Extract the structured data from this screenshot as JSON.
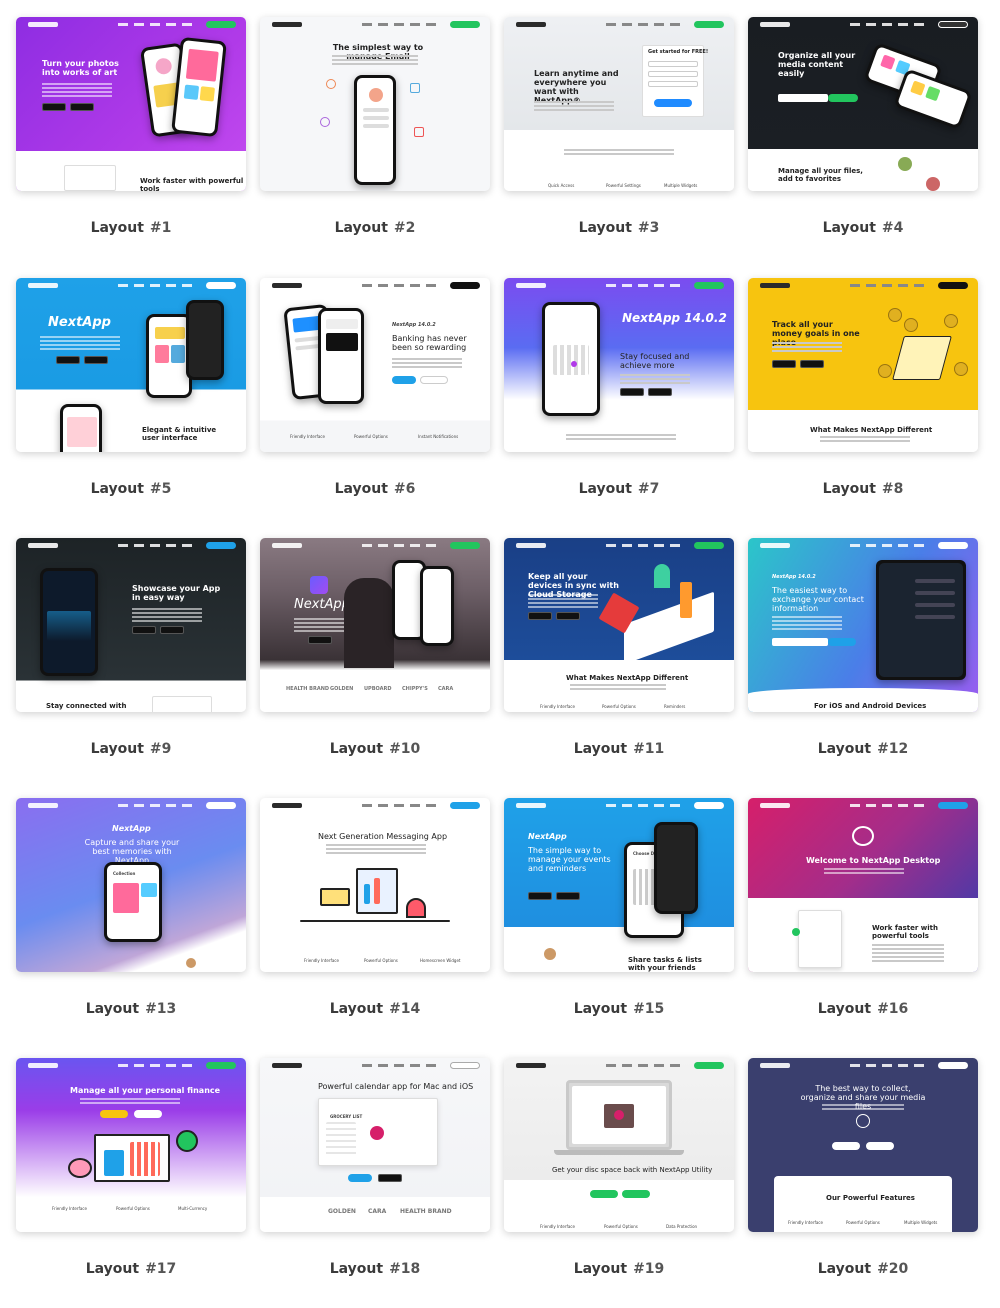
{
  "layouts": [
    {
      "label": "Layout",
      "num": "#1",
      "headline": "Turn your photos into works of art",
      "lower": "Work faster with powerful tools"
    },
    {
      "label": "Layout",
      "num": "#2",
      "headline": "The simplest way to manage Email"
    },
    {
      "label": "Layout",
      "num": "#3",
      "headline": "Learn anytime and everywhere you want with NextApp®",
      "form_title": "Get started for FREE!",
      "features": [
        "Quick Access",
        "Powerful Settings",
        "Multiple Widgets"
      ]
    },
    {
      "label": "Layout",
      "num": "#4",
      "headline": "Organize all your media content easily",
      "lower": "Manage all your files, add to favorites"
    },
    {
      "label": "Layout",
      "num": "#5",
      "headline": "NextApp",
      "lower": "Elegant & intuitive user interface"
    },
    {
      "label": "Layout",
      "num": "#6",
      "kicker": "NextApp 14.0.2",
      "headline": "Banking has never been so rewarding",
      "features": [
        "Friendly Interface",
        "Powerful Options",
        "Instant Notifications"
      ]
    },
    {
      "label": "Layout",
      "num": "#7",
      "kicker": "NextApp 14.0.2",
      "headline": "Stay focused and achieve more"
    },
    {
      "label": "Layout",
      "num": "#8",
      "headline": "Track all your money goals in one place",
      "lower": "What Makes NextApp Different"
    },
    {
      "label": "Layout",
      "num": "#9",
      "headline": "Showcase your App in easy way",
      "lower": "Stay connected with"
    },
    {
      "label": "Layout",
      "num": "#10",
      "headline": "NextApp",
      "brands": [
        "HEALTH BRAND",
        "GOLDEN",
        "UPBOARD",
        "CHIPPY'S",
        "CARA"
      ]
    },
    {
      "label": "Layout",
      "num": "#11",
      "headline": "Keep all your devices in sync with Cloud Storage",
      "lower": "What Makes NextApp Different",
      "features": [
        "Friendly Interface",
        "Powerful Options",
        "Reminders"
      ]
    },
    {
      "label": "Layout",
      "num": "#12",
      "kicker": "NextApp 14.0.2",
      "headline": "The easiest way to exchange your contact information",
      "lower": "For iOS and Android Devices"
    },
    {
      "label": "Layout",
      "num": "#13",
      "kicker": "NextApp",
      "headline": "Capture and share your best memories with NextApp",
      "screen_title": "Collection"
    },
    {
      "label": "Layout",
      "num": "#14",
      "headline": "Next Generation Messaging App",
      "features": [
        "Friendly Interface",
        "Powerful Options",
        "Homescreen Widget"
      ]
    },
    {
      "label": "Layout",
      "num": "#15",
      "kicker": "NextApp",
      "headline": "The simple way to manage your events and reminders",
      "screen_title": "Choose Date",
      "lower": "Share tasks & lists with your friends"
    },
    {
      "label": "Layout",
      "num": "#16",
      "headline": "Welcome to NextApp Desktop",
      "lower": "Work faster with powerful tools"
    },
    {
      "label": "Layout",
      "num": "#17",
      "headline": "Manage all your personal finance",
      "features": [
        "Friendly Interface",
        "Powerful Options",
        "Multi-Currency"
      ]
    },
    {
      "label": "Layout",
      "num": "#18",
      "headline": "Powerful calendar app for Mac and iOS",
      "screen_title": "GROCERY LIST",
      "brands": [
        "GOLDEN",
        "CARA",
        "HEALTH BRAND"
      ]
    },
    {
      "label": "Layout",
      "num": "#19",
      "headline": "Get your disc space back with NextApp Utility",
      "features": [
        "Friendly Interface",
        "Powerful Options",
        "Data Protection"
      ]
    },
    {
      "label": "Layout",
      "num": "#20",
      "headline": "The best way to collect, organize and share your media files",
      "lower": "Our Powerful Features",
      "features": [
        "Friendly Interface",
        "Powerful Options",
        "Multiple Widgets"
      ]
    }
  ],
  "colors": {
    "green_button": "#22c55e",
    "purple": "#9b3cf0",
    "blue": "#1fa1e8",
    "yellow": "#f7c40f",
    "dark": "#1b1f24",
    "navy": "#3a3f6e",
    "pink": "#d61f6a"
  }
}
